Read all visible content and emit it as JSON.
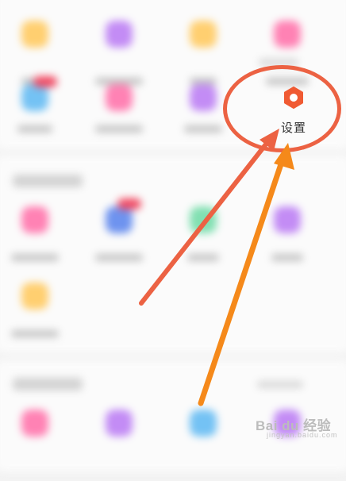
{
  "settings": {
    "label": "设置",
    "icon": "hexagon-gear-icon",
    "accent": "#f05a33"
  },
  "annotations": {
    "ellipse_color": "#ec6243",
    "red_arrow_color": "#ec6243",
    "orange_arrow_color": "#f5891a"
  },
  "watermark": {
    "text": "Bai du 经验",
    "sub": "jingyan.baidu.com"
  },
  "colors": {
    "yellow": "#ffcf70",
    "purple": "#c38cf5",
    "pink": "#ff82b4",
    "blue": "#74c2f4",
    "green": "#82e0b2",
    "badge": "#f14a63"
  }
}
